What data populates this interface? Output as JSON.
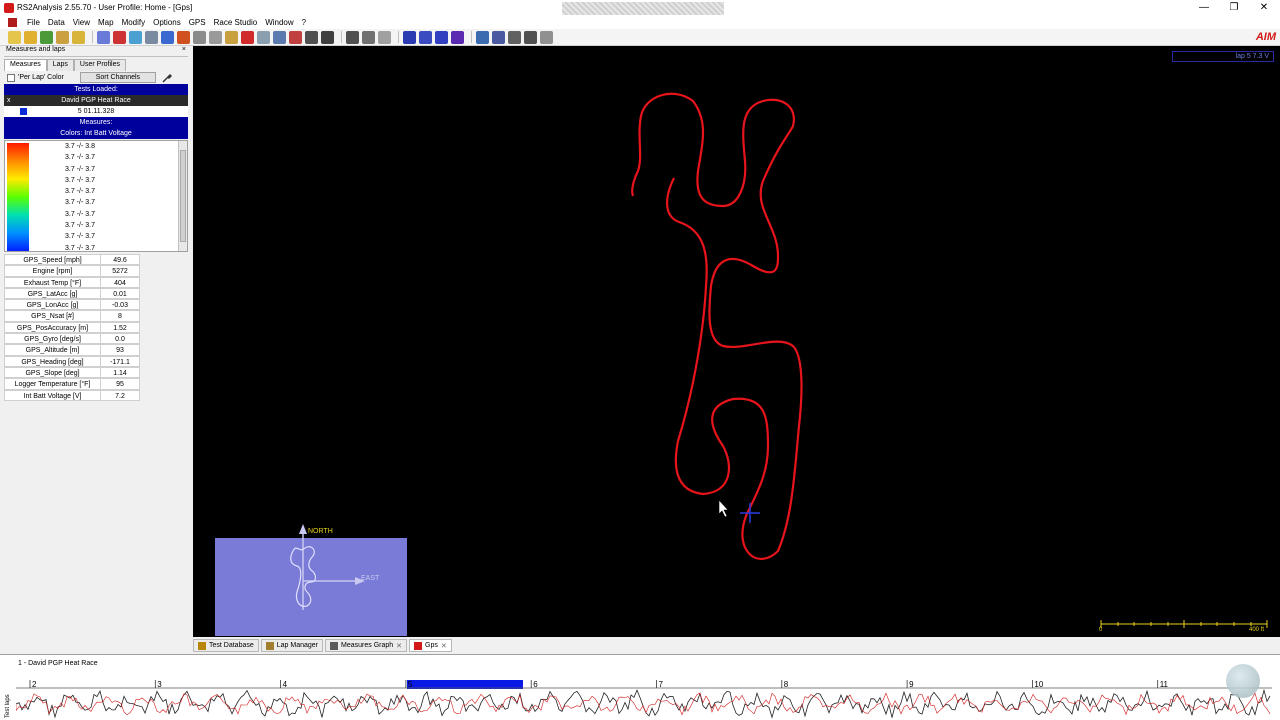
{
  "window": {
    "title": "RS2Analysis 2.55.70 - User Profile: Home - [Gps]",
    "controls": [
      "—",
      "❐",
      "✕"
    ]
  },
  "menu": [
    "File",
    "Data",
    "View",
    "Map",
    "Modify",
    "Options",
    "GPS",
    "Race Studio",
    "Window",
    "?"
  ],
  "brand": "AIM",
  "left_panel": {
    "header": "Measures and laps",
    "close": "×",
    "tabs": [
      "Measures",
      "Laps",
      "User Profiles"
    ],
    "per_lap_color": "'Per Lap' Color",
    "sort_button": "Sort Channels",
    "tests_loaded": "Tests Loaded:",
    "test_name": "David PGP Heat Race",
    "test_close": "x",
    "lap_time": "5 01.11.328",
    "measures_header": "Measures:",
    "colors_label": "Colors: Int Batt Voltage",
    "legend_items": [
      "3.7 -/- 3.8",
      "3.7 -/- 3.7",
      "3.7 -/- 3.7",
      "3.7 -/- 3.7",
      "3.7 -/- 3.7",
      "3.7 -/- 3.7",
      "3.7 -/- 3.7",
      "3.7 -/- 3.7",
      "3.7 -/- 3.7",
      "3.7 -/- 3.7"
    ],
    "measures": [
      {
        "name": "GPS_Speed   [mph]",
        "value": "49.6"
      },
      {
        "name": "Engine   [rpm]",
        "value": "5272"
      },
      {
        "name": "Exhaust Temp   [°F]",
        "value": "404"
      },
      {
        "name": "GPS_LatAcc   [g]",
        "value": "0.01"
      },
      {
        "name": "GPS_LonAcc   [g]",
        "value": "-0.03"
      },
      {
        "name": "GPS_Nsat   [#]",
        "value": "8"
      },
      {
        "name": "GPS_PosAccuracy   [m]",
        "value": "1.52"
      },
      {
        "name": "GPS_Gyro   [deg/s]",
        "value": "0.0"
      },
      {
        "name": "GPS_Altitude   [m]",
        "value": "93"
      },
      {
        "name": "GPS_Heading   [deg]",
        "value": "-171.1"
      },
      {
        "name": "GPS_Slope   [deg]",
        "value": "1.14"
      },
      {
        "name": "Logger Temperature   [°F]",
        "value": "95"
      },
      {
        "name": "Int Batt Voltage   [V]",
        "value": "7.2"
      }
    ]
  },
  "gps_view": {
    "top_tag": "lap 5 7.3 V",
    "north_label": "NORTH",
    "east_label": "EAST",
    "scale_start": "0",
    "scale_end": "400 ft",
    "track_color": "#e8141c"
  },
  "doc_tabs": [
    {
      "label": "Test Database",
      "icon": "database-icon",
      "close": ""
    },
    {
      "label": "Lap Manager",
      "icon": "lap-manager-icon",
      "close": ""
    },
    {
      "label": "Measures Graph",
      "icon": "graph-icon",
      "close": "✕"
    },
    {
      "label": "Gps",
      "icon": "gps-icon",
      "close": "✕"
    }
  ],
  "bottom_panel": {
    "title": "1 - David PGP Heat Race",
    "side_label": "Test laps",
    "lap_numbers": [
      "2",
      "3",
      "4",
      "5",
      "6",
      "7",
      "8",
      "9",
      "10",
      "11"
    ],
    "selected_lap": "5"
  }
}
